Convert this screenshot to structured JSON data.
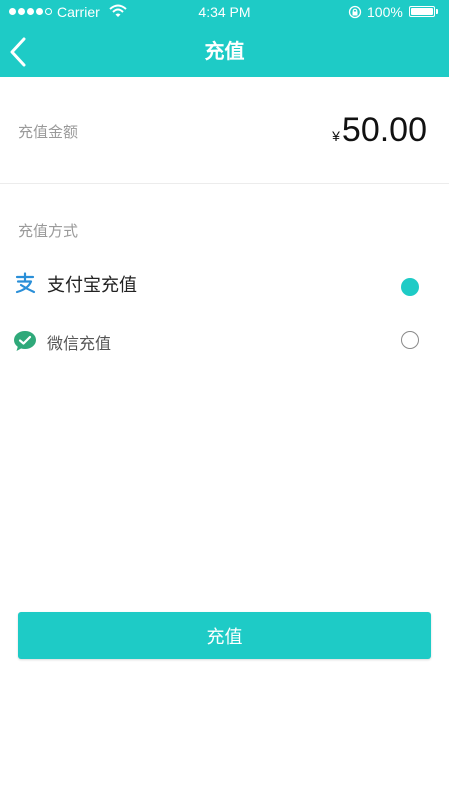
{
  "theme": {
    "accent": "#1ecbc6",
    "background": "#ffffff"
  },
  "status_bar": {
    "carrier": "Carrier",
    "time": "4:34 PM",
    "battery": "100%"
  },
  "nav": {
    "back_icon": "chevron-left-icon",
    "title": "充值"
  },
  "amount": {
    "label": "充值金额",
    "currency": "¥",
    "value": "50.00"
  },
  "payment": {
    "section_label": "充值方式",
    "options": [
      {
        "icon": "alipay-icon",
        "label": "支付宝充值",
        "selected": true
      },
      {
        "icon": "wechat-icon",
        "label": "微信充值",
        "selected": false
      }
    ]
  },
  "submit": {
    "label": "充值"
  }
}
